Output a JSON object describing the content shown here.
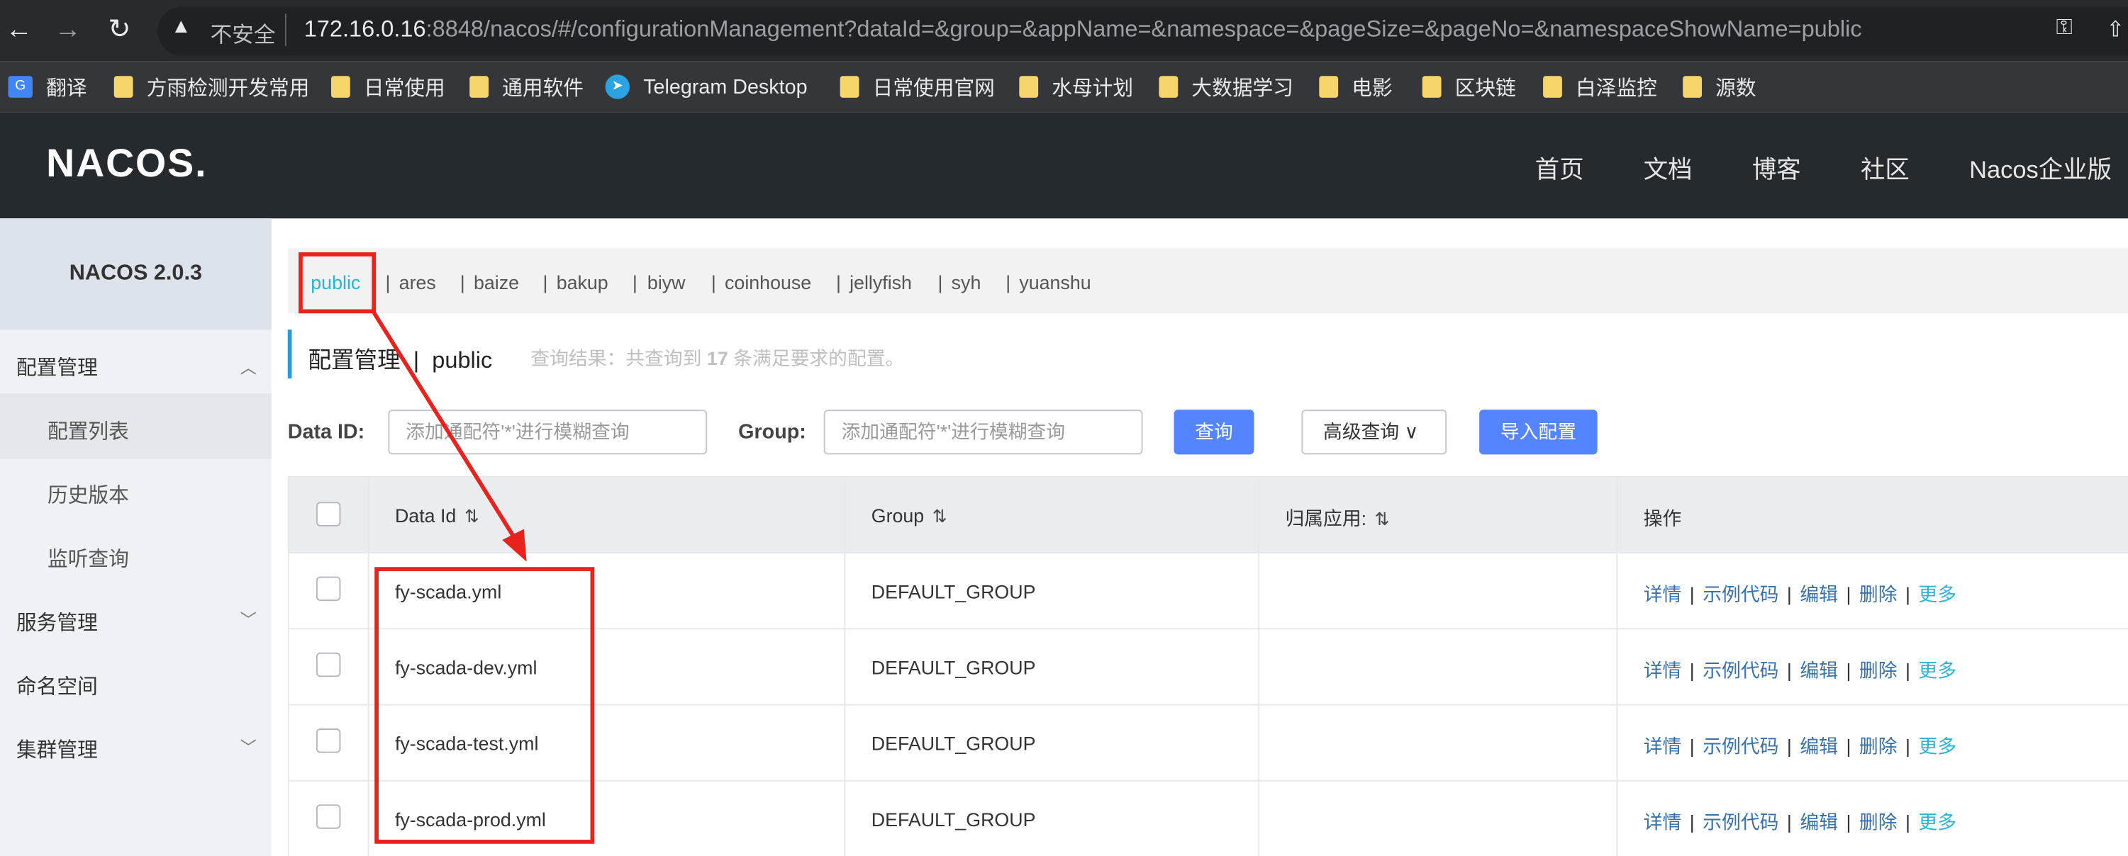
{
  "browser": {
    "url_insecure": "不安全",
    "url_host": "172.16.0.16",
    "url_rest": ":8848/nacos/#/configurationManagement?dataId=&group=&appName=&namespace=&pageSize=&pageNo=&namespaceShowName=public",
    "bookmarks": [
      "翻译",
      "方雨检测开发常用",
      "日常使用",
      "通用软件",
      "Telegram Desktop",
      "日常使用官网",
      "水母计划",
      "大数据学习",
      "电影",
      "区块链",
      "白泽监控",
      "源数"
    ]
  },
  "header": {
    "logo": "NACOS.",
    "nav": [
      "首页",
      "文档",
      "博客",
      "社区",
      "Nacos企业版"
    ]
  },
  "sidebar": {
    "title": "NACOS 2.0.3",
    "groups": {
      "config": "配置管理",
      "config_list": "配置列表",
      "history": "历史版本",
      "listener": "监听查询",
      "service": "服务管理",
      "namespace": "命名空间",
      "cluster": "集群管理"
    }
  },
  "namespaces": [
    "public",
    "ares",
    "baize",
    "bakup",
    "biyw",
    "coinhouse",
    "jellyfish",
    "syh",
    "yuanshu"
  ],
  "page": {
    "title": "配置管理",
    "separator": "|",
    "namespace": "public",
    "query_prefix": "查询结果：共查询到",
    "query_count": "17",
    "query_suffix": "条满足要求的配置。"
  },
  "search": {
    "dataid_label": "Data ID:",
    "dataid_placeholder": "添加通配符'*'进行模糊查询",
    "group_label": "Group:",
    "group_placeholder": "添加通配符'*'进行模糊查询",
    "query_button": "查询",
    "advanced_button": "高级查询",
    "import_button": "导入配置"
  },
  "table": {
    "headers": {
      "dataid": "Data Id",
      "group": "Group",
      "app": "归属应用:",
      "ops": "操作"
    },
    "sort_icon": "sort-icon",
    "rows": [
      {
        "dataid": "fy-scada.yml",
        "group": "DEFAULT_GROUP"
      },
      {
        "dataid": "fy-scada-dev.yml",
        "group": "DEFAULT_GROUP"
      },
      {
        "dataid": "fy-scada-test.yml",
        "group": "DEFAULT_GROUP"
      },
      {
        "dataid": "fy-scada-prod.yml",
        "group": "DEFAULT_GROUP"
      }
    ],
    "ops": {
      "detail": "详情",
      "sample": "示例代码",
      "edit": "编辑",
      "delete": "删除",
      "more": "更多",
      "sep": "|"
    }
  },
  "colors": {
    "accent": "#5584ff",
    "annotation": "#e8231d",
    "header_bg": "#252a2f"
  }
}
